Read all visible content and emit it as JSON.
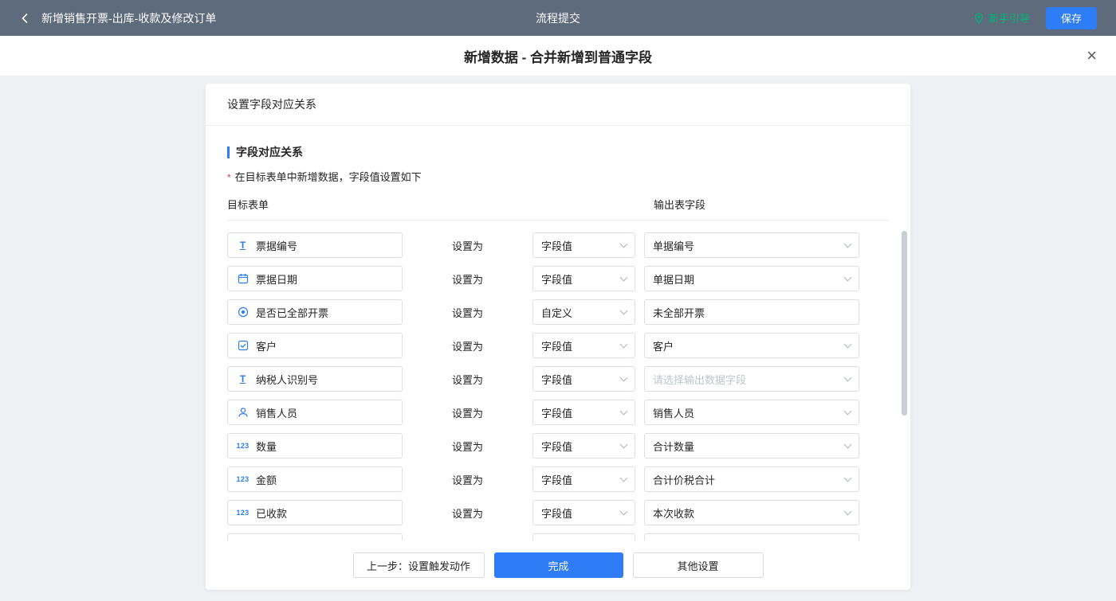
{
  "topbar": {
    "title": "新增销售开票-出库-收款及修改订单",
    "center": "流程提交",
    "guide": "新手引导",
    "save": "保存"
  },
  "modal": {
    "title": "新增数据 - 合并新增到普通字段"
  },
  "panel": {
    "header": "设置字段对应关系",
    "section": "字段对应关系",
    "required_mark": "*",
    "hint": "在目标表单中新增数据，字段值设置如下",
    "columns": {
      "left": "目标表单",
      "right": "输出表字段"
    },
    "set_as": "设置为",
    "rows": [
      {
        "icon": "text-field-icon",
        "field": "票据编号",
        "mode": "字段值",
        "output": "单据编号"
      },
      {
        "icon": "date-field-icon",
        "field": "票据日期",
        "mode": "字段值",
        "output": "单据日期"
      },
      {
        "icon": "radio-field-icon",
        "field": "是否已全部开票",
        "mode": "自定义",
        "output": "未全部开票"
      },
      {
        "icon": "select-field-icon",
        "field": "客户",
        "mode": "字段值",
        "output": "客户"
      },
      {
        "icon": "text-field-icon",
        "field": "纳税人识别号",
        "mode": "字段值",
        "output": "请选择输出数据字段"
      },
      {
        "icon": "user-field-icon",
        "field": "销售人员",
        "mode": "字段值",
        "output": "销售人员"
      },
      {
        "icon": "number-field-icon",
        "field": "数量",
        "mode": "字段值",
        "output": "合计数量"
      },
      {
        "icon": "number-field-icon",
        "field": "金额",
        "mode": "字段值",
        "output": "合计价税合计"
      },
      {
        "icon": "number-field-icon",
        "field": "已收款",
        "mode": "字段值",
        "output": "本次收款"
      }
    ]
  },
  "footer": {
    "prev": "上一步：设置触发动作",
    "done": "完成",
    "other": "其他设置"
  },
  "colors": {
    "accent": "#2e7cf6",
    "topbar_bg": "#5e6b7c",
    "guide_green": "#00b578",
    "danger": "#e63757"
  }
}
